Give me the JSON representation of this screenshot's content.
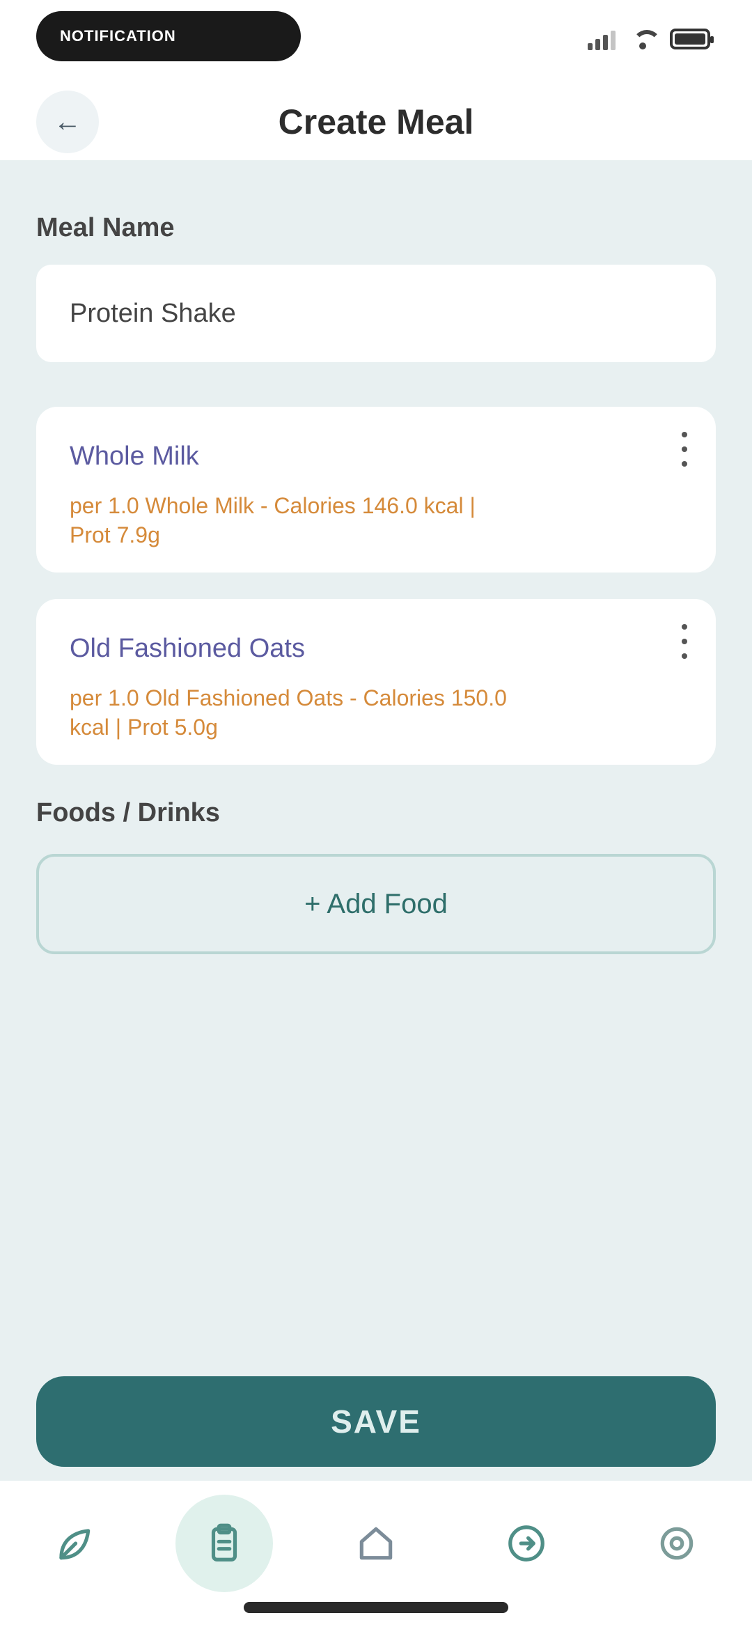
{
  "status_bar": {
    "pill_text": "NOTIFICATION"
  },
  "header": {
    "title": "Create Meal"
  },
  "form": {
    "meal_name_label": "Meal Name",
    "meal_name_value": "Protein Shake",
    "foods_label": "Foods / Drinks",
    "add_food_label": "+ Add Food"
  },
  "foods": [
    {
      "name": "Whole Milk",
      "detail": "per 1.0 Whole Milk - Calories 146.0 kcal | Prot 7.9g"
    },
    {
      "name": "Old Fashioned Oats",
      "detail": "per 1.0 Old Fashioned Oats - Calories 150.0 kcal | Prot 5.0g"
    }
  ],
  "save_label": "SAVE",
  "bottom_nav": {
    "items": [
      "leaf-icon",
      "clipboard-icon",
      "home-icon",
      "share-icon",
      "settings-icon"
    ],
    "active_index": 1
  },
  "colors": {
    "accent": "#2e6e70",
    "food_name": "#5b5aa0",
    "food_detail": "#d58a3a",
    "background": "#e8f0f1"
  }
}
